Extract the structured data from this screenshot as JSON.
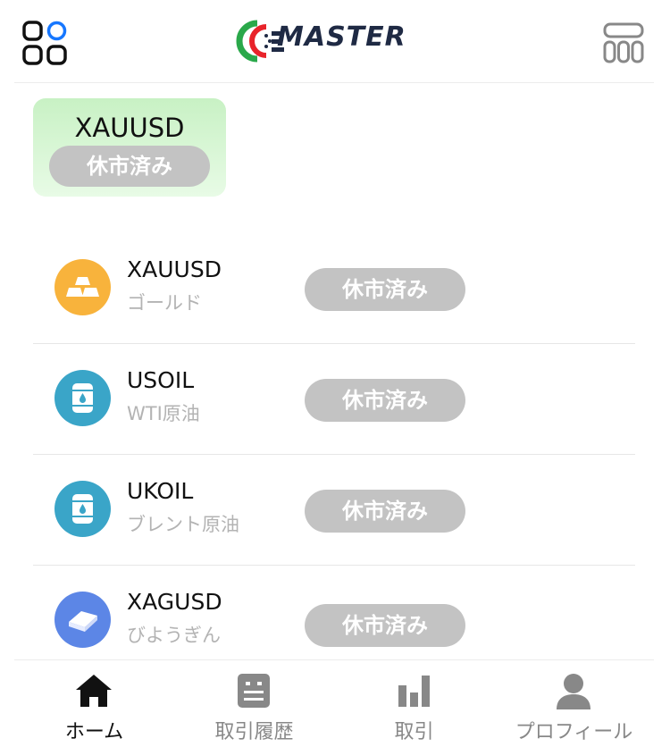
{
  "header": {
    "logo_text": "MASTER",
    "menu_icon": "apps-grid-icon",
    "ticket_icon": "ticket-counter-icon"
  },
  "featured": {
    "symbol": "XAUUSD",
    "status": "休市済み"
  },
  "instruments": [
    {
      "symbol": "XAUUSD",
      "name": "ゴールド",
      "status": "休市済み",
      "icon": "gold-bars-icon",
      "color": "#f8b33c"
    },
    {
      "symbol": "USOIL",
      "name": "WTI原油",
      "status": "休市済み",
      "icon": "oil-barrel-icon",
      "color": "#3aa5c8"
    },
    {
      "symbol": "UKOIL",
      "name": "ブレント原油",
      "status": "休市済み",
      "icon": "oil-barrel-icon",
      "color": "#3aa5c8"
    },
    {
      "symbol": "XAGUSD",
      "name": "びようぎん",
      "status": "休市済み",
      "icon": "silver-bar-icon",
      "color": "#5c86e6"
    }
  ],
  "nav": [
    {
      "label": "ホーム",
      "icon": "home-icon",
      "active": true
    },
    {
      "label": "取引履歴",
      "icon": "history-list-icon",
      "active": false
    },
    {
      "label": "取引",
      "icon": "bar-chart-icon",
      "active": false
    },
    {
      "label": "プロフィール",
      "icon": "profile-icon",
      "active": false
    }
  ],
  "colors": {
    "status_pill": "#c3c3c3",
    "featured_bg": "#c8f1c4",
    "logo_red": "#e8232a",
    "logo_green": "#2aa84a",
    "logo_navy": "#1f2a44"
  }
}
